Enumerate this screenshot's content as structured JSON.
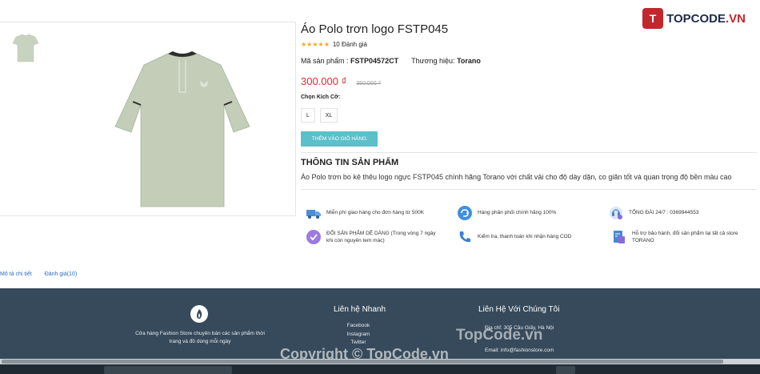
{
  "brand_watermark": {
    "badge": "T",
    "name_part1": "TOPCODE",
    "name_part2": ".VN"
  },
  "product": {
    "title": "Áo Polo trơn logo FSTP045",
    "stars": "★★★★★",
    "review_count": "10 Đánh giá",
    "sku_label": "Mã sản phẩm :",
    "sku": "FSTP04572CT",
    "brand_label": "Thương hiệu:",
    "brand": "Torano",
    "price": "300.000 ₫",
    "old_price": "350.000 ₫",
    "size_label": "Chọn Kích Cỡ:",
    "sizes": [
      "L",
      "XL"
    ],
    "cart_button": "THÊM VÀO GIỎ HÀNG",
    "info_title": "THÔNG TIN SẢN PHẨM",
    "info_desc": "Áo Polo trơn bo kẻ thêu logo ngực FSTP045 chính hãng Torano với chất vải cho độ dày dặn, co giãn tốt và quan trọng độ bền màu cao"
  },
  "features": {
    "f1": {
      "icon": "free-shipping-icon",
      "line1": "Miễn phí giao hàng cho đơn hàng từ 500K"
    },
    "f2": {
      "icon": "authentic-icon",
      "line1": "Hàng phân phối chính hãng 100%"
    },
    "f3": {
      "icon": "hotline-icon",
      "line1": "TỔNG ĐÀI 24/7 : 0369944553"
    },
    "f4": {
      "icon": "exchange-icon",
      "line1": "ĐỔI SẢN PHẨM DỄ DÀNG (Trong vòng 7 ngày",
      "line2": "khi còn nguyên tem mác)"
    },
    "f5": {
      "icon": "cod-phone-icon",
      "line1": "Kiểm tra, thanh toán khi nhận hàng COD"
    },
    "f6": {
      "icon": "warranty-icon",
      "line1": "Hỗ trợ bảo hành, đổi sản phẩm tại tất cả store",
      "line2": "TORANO"
    }
  },
  "tabs": {
    "detail": "Mô tả chi tiết",
    "reviews": "Đánh giá(10)"
  },
  "footer": {
    "desc_line1": "Cửa hàng Fashion Store chuyên bán các sản phẩm thời",
    "desc_line2": "trang và đồ dùng mỗi ngày",
    "quick_title": "Liên hệ Nhanh",
    "links": [
      "Facebook",
      "Instagram",
      "Twitter"
    ],
    "contact_title": "Liên Hệ Với Chúng Tôi",
    "address": "Địa chỉ: 305 Cầu Giấy, Hà Nội",
    "email": "Email: info@fashionstore.com"
  },
  "watermarks": {
    "center": "TopCode.vn",
    "copyright": "Copyright © TopCode.vn"
  },
  "colors": {
    "accent": "#5bc0c9",
    "price": "#d0312d",
    "footer": "#364a5b"
  }
}
